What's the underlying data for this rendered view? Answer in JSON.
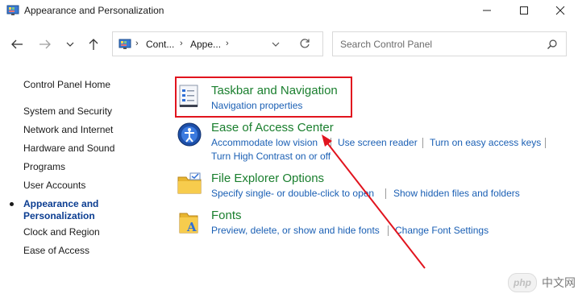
{
  "window": {
    "title": "Appearance and Personalization"
  },
  "address": {
    "crumbs": [
      "Cont...",
      "Appe..."
    ]
  },
  "search": {
    "placeholder": "Search Control Panel"
  },
  "sidebar": {
    "items": [
      {
        "label": "Control Panel Home"
      },
      {
        "label": "System and Security"
      },
      {
        "label": "Network and Internet"
      },
      {
        "label": "Hardware and Sound"
      },
      {
        "label": "Programs"
      },
      {
        "label": "User Accounts"
      },
      {
        "label": "Appearance and Personalization",
        "line1": "Appearance and",
        "line2": "Personalization",
        "current": true
      },
      {
        "label": "Clock and Region"
      },
      {
        "label": "Ease of Access"
      }
    ]
  },
  "categories": [
    {
      "title": "Taskbar and Navigation",
      "links": [
        "Navigation properties"
      ]
    },
    {
      "title": "Ease of Access Center",
      "links": [
        "Accommodate low vision",
        "Use screen reader",
        "Turn on easy access keys",
        "Turn High Contrast on or off"
      ]
    },
    {
      "title": "File Explorer Options",
      "links": [
        "Specify single- or double-click to open",
        "Show hidden files and folders"
      ]
    },
    {
      "title": "Fonts",
      "links": [
        "Preview, delete, or show and hide fonts",
        "Change Font Settings"
      ]
    }
  ],
  "watermark": {
    "badge": "php",
    "text": "中文网"
  },
  "colors": {
    "category_title": "#1a7f2e",
    "link": "#1a5fb4",
    "highlight": "#e1141e"
  }
}
